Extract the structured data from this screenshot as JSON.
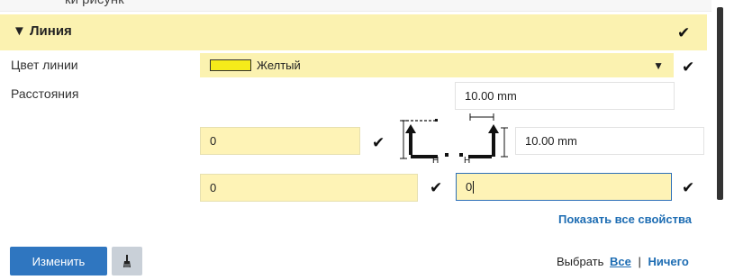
{
  "header_partial": "ки рисунк",
  "section": {
    "title": "Линия",
    "toggle_glyph": "▼"
  },
  "rows": {
    "line_color": {
      "label": "Цвет линии",
      "value": "Желтый"
    },
    "distances": {
      "label": "Расстояния",
      "value": "10.00 mm"
    }
  },
  "offset_row1": {
    "left_value": "0",
    "right_value": "10.00 mm",
    "diagram_label_1": "H",
    "diagram_label_2": "H"
  },
  "offset_row2": {
    "left_value": "0",
    "right_value": "0"
  },
  "links": {
    "show_all": "Показать все свойства",
    "select_prefix": "Выбрать",
    "select_all": "Все",
    "separator": "|",
    "select_none": "Ничего"
  },
  "buttons": {
    "modify": "Изменить"
  },
  "icons": {
    "check": "✔",
    "dropdown": "▼",
    "brush": "brush-icon",
    "offset_diagram": "offset-diagram-icon"
  },
  "colors": {
    "swatch": "#f5eb1a",
    "highlight": "#fbf2b0",
    "primary": "#2f76c0"
  }
}
